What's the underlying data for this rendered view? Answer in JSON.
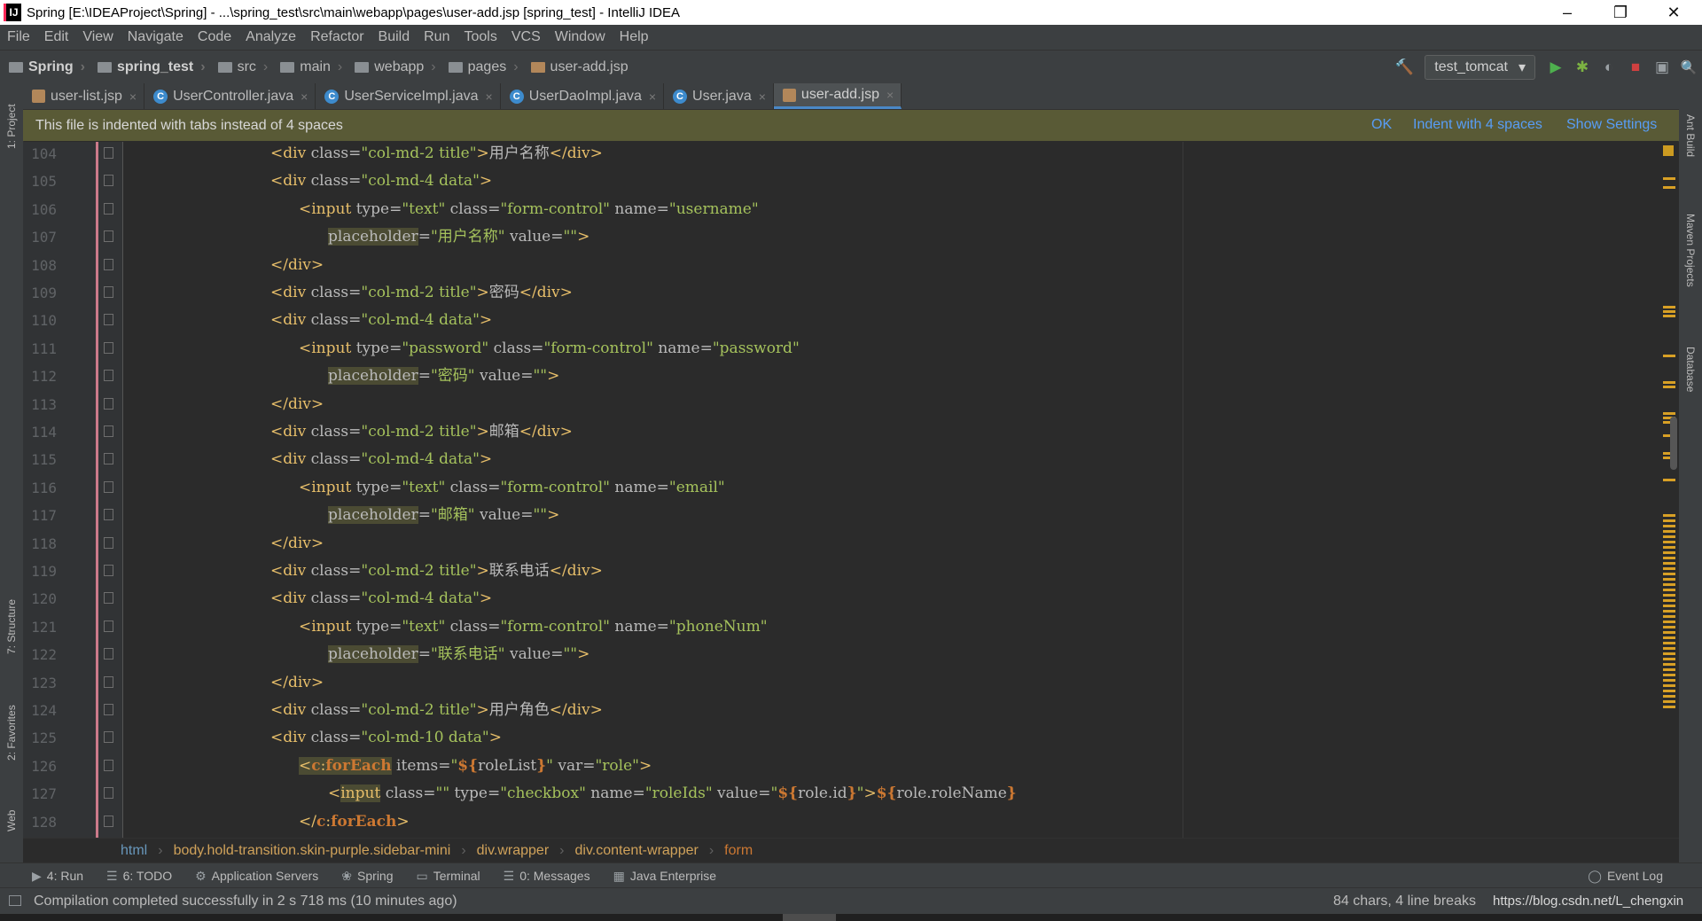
{
  "window": {
    "title": "Spring [E:\\IDEAProject\\Spring] - ...\\spring_test\\src\\main\\webapp\\pages\\user-add.jsp [spring_test] - IntelliJ IDEA",
    "icon_letter": "IJ",
    "controls": {
      "minimize": "–",
      "maximize": "❐",
      "close": "✕"
    }
  },
  "menu": [
    "File",
    "Edit",
    "View",
    "Navigate",
    "Code",
    "Analyze",
    "Refactor",
    "Build",
    "Run",
    "Tools",
    "VCS",
    "Window",
    "Help"
  ],
  "breadcrumbs": [
    "Spring",
    "spring_test",
    "src",
    "main",
    "webapp",
    "pages",
    "user-add.jsp"
  ],
  "run_config": {
    "label": "test_tomcat",
    "dropdown": "▾"
  },
  "toolbar_icons": {
    "build": "🔨",
    "run": "▶",
    "debug": "✱",
    "coverage": "◐",
    "stop": "■",
    "structure": "▣",
    "search": "🔍"
  },
  "tabs": [
    {
      "label": "user-list.jsp",
      "kind": "jsp",
      "active": false
    },
    {
      "label": "UserController.java",
      "kind": "class",
      "active": false
    },
    {
      "label": "UserServiceImpl.java",
      "kind": "class",
      "active": false
    },
    {
      "label": "UserDaoImpl.java",
      "kind": "class",
      "active": false
    },
    {
      "label": "User.java",
      "kind": "class",
      "active": false
    },
    {
      "label": "user-add.jsp",
      "kind": "jsp",
      "active": true
    }
  ],
  "tab_close": "×",
  "notice": {
    "message": "This file is indented with tabs instead of 4 spaces",
    "actions": [
      "OK",
      "Indent with 4 spaces",
      "Show Settings"
    ]
  },
  "left_panels": [
    "1: Project",
    "7: Structure",
    "2: Favorites",
    "Web"
  ],
  "right_panels": [
    "Ant Build",
    "Maven Projects",
    "Database"
  ],
  "code_lines": [
    {
      "n": "104",
      "html": "<span class=\"t\">&lt;div </span><span class=\"a\">class=</span><span class=\"s\">\"col-md-2 title\"</span><span class=\"t\">&gt;</span><span class=\"p\">用户名称</span><span class=\"t\">&lt;/div&gt;</span>",
      "indent": 279
    },
    {
      "n": "105",
      "html": "<span class=\"t\">&lt;div </span><span class=\"a\">class=</span><span class=\"s\">\"col-md-4 data\"</span><span class=\"t\">&gt;</span>",
      "indent": 279
    },
    {
      "n": "106",
      "html": "<span class=\"t\">&lt;input </span><span class=\"a\">type=</span><span class=\"s\">\"text\"</span><span class=\"a\"> class=</span><span class=\"s\">\"form-control\"</span><span class=\"a\"> name=</span><span class=\"s\">\"username\"</span>",
      "indent": 311
    },
    {
      "n": "107",
      "html": "<span class=\"a hl\">placeholder</span><span class=\"a\">=</span><span class=\"s\">\"用户名称\"</span><span class=\"a\"> value=</span><span class=\"s\">\"\"</span><span class=\"t\">&gt;</span>",
      "indent": 344
    },
    {
      "n": "108",
      "html": "<span class=\"t\">&lt;/div&gt;</span>",
      "indent": 279
    },
    {
      "n": "109",
      "html": "<span class=\"t\">&lt;div </span><span class=\"a\">class=</span><span class=\"s\">\"col-md-2 title\"</span><span class=\"t\">&gt;</span><span class=\"p\">密码</span><span class=\"t\">&lt;/div&gt;</span>",
      "indent": 279
    },
    {
      "n": "110",
      "html": "<span class=\"t\">&lt;div </span><span class=\"a\">class=</span><span class=\"s\">\"col-md-4 data\"</span><span class=\"t\">&gt;</span>",
      "indent": 279
    },
    {
      "n": "111",
      "html": "<span class=\"t\">&lt;input </span><span class=\"a\">type=</span><span class=\"s\">\"password\"</span><span class=\"a\"> class=</span><span class=\"s\">\"form-control\"</span><span class=\"a\"> name=</span><span class=\"s\">\"password\"</span>",
      "indent": 311
    },
    {
      "n": "112",
      "html": "<span class=\"a hl\">placeholder</span><span class=\"a\">=</span><span class=\"s\">\"密码\"</span><span class=\"a\"> value=</span><span class=\"s\">\"\"</span><span class=\"t\">&gt;</span>",
      "indent": 344
    },
    {
      "n": "113",
      "html": "<span class=\"t\">&lt;/div&gt;</span>",
      "indent": 279
    },
    {
      "n": "114",
      "html": "<span class=\"t\">&lt;div </span><span class=\"a\">class=</span><span class=\"s\">\"col-md-2 title\"</span><span class=\"t\">&gt;</span><span class=\"p\">邮箱</span><span class=\"t\">&lt;/div&gt;</span>",
      "indent": 279
    },
    {
      "n": "115",
      "html": "<span class=\"t\">&lt;div </span><span class=\"a\">class=</span><span class=\"s\">\"col-md-4 data\"</span><span class=\"t\">&gt;</span>",
      "indent": 279
    },
    {
      "n": "116",
      "html": "<span class=\"t\">&lt;input </span><span class=\"a\">type=</span><span class=\"s\">\"text\"</span><span class=\"a\"> class=</span><span class=\"s\">\"form-control\"</span><span class=\"a\"> name=</span><span class=\"s\">\"email\"</span>",
      "indent": 311
    },
    {
      "n": "117",
      "html": "<span class=\"a hl\">placeholder</span><span class=\"a\">=</span><span class=\"s\">\"邮箱\"</span><span class=\"a\"> value=</span><span class=\"s\">\"\"</span><span class=\"t\">&gt;</span>",
      "indent": 344
    },
    {
      "n": "118",
      "html": "<span class=\"t\">&lt;/div&gt;</span>",
      "indent": 279
    },
    {
      "n": "119",
      "html": "<span class=\"t\">&lt;div </span><span class=\"a\">class=</span><span class=\"s\">\"col-md-2 title\"</span><span class=\"t\">&gt;</span><span class=\"p\">联系电话</span><span class=\"t\">&lt;/div&gt;</span>",
      "indent": 279
    },
    {
      "n": "120",
      "html": "<span class=\"t\">&lt;div </span><span class=\"a\">class=</span><span class=\"s\">\"col-md-4 data\"</span><span class=\"t\">&gt;</span>",
      "indent": 279
    },
    {
      "n": "121",
      "html": "<span class=\"t\">&lt;input </span><span class=\"a\">type=</span><span class=\"s\">\"text\"</span><span class=\"a\"> class=</span><span class=\"s\">\"form-control\"</span><span class=\"a\"> name=</span><span class=\"s\">\"phoneNum\"</span>",
      "indent": 311
    },
    {
      "n": "122",
      "html": "<span class=\"a hl\">placeholder</span><span class=\"a\">=</span><span class=\"s\">\"联系电话\"</span><span class=\"a\"> value=</span><span class=\"s\">\"\"</span><span class=\"t\">&gt;</span>",
      "indent": 344
    },
    {
      "n": "123",
      "html": "<span class=\"t\">&lt;/div&gt;</span>",
      "indent": 279
    },
    {
      "n": "124",
      "html": "<span class=\"t\">&lt;div </span><span class=\"a\">class=</span><span class=\"s\">\"col-md-2 title\"</span><span class=\"t\">&gt;</span><span class=\"p\">用户角色</span><span class=\"t\">&lt;/div&gt;</span>",
      "indent": 279
    },
    {
      "n": "125",
      "html": "<span class=\"t\">&lt;div </span><span class=\"a\">class=</span><span class=\"s\">\"col-md-10 data\"</span><span class=\"t\">&gt;</span>",
      "indent": 279
    },
    {
      "n": "126",
      "html": "<span class=\"t hl\">&lt;</span><span class=\"k hl\">c</span><span class=\"t hl\">:</span><span class=\"k hl\">forEach</span><span class=\"a\"> items=</span><span class=\"s\">\"</span><span class=\"k\">${</span><span class=\"p\">roleList</span><span class=\"k\">}</span><span class=\"s\">\"</span><span class=\"a\"> var=</span><span class=\"s\">\"role\"</span><span class=\"t\">&gt;</span>",
      "indent": 311
    },
    {
      "n": "127",
      "html": "<span class=\"t\">&lt;</span><span class=\"t hl\">input</span><span class=\"a\"> class=</span><span class=\"s\">\"\"</span><span class=\"a\"> type=</span><span class=\"s\">\"checkbox\"</span><span class=\"a\"> name=</span><span class=\"s\">\"roleIds\"</span><span class=\"a\"> value=</span><span class=\"s\">\"</span><span class=\"k\">${</span><span class=\"p\">role.id</span><span class=\"k\">}</span><span class=\"s\">\"</span><span class=\"t\">&gt;</span><span class=\"k\">${</span><span class=\"p\">role.roleName</span><span class=\"k\">}</span>",
      "indent": 344
    },
    {
      "n": "128",
      "html": "<span class=\"t\">&lt;/</span><span class=\"k\">c</span><span class=\"t\">:</span><span class=\"k\">forEach</span><span class=\"t\">&gt;</span>",
      "indent": 311
    }
  ],
  "bottom_breadcrumbs": [
    "html",
    "body.hold-transition.skin-purple.sidebar-mini",
    "div.wrapper",
    "div.content-wrapper",
    "form"
  ],
  "tool_windows": [
    {
      "icon": "▶",
      "label": "4: Run"
    },
    {
      "icon": "☰",
      "label": "6: TODO"
    },
    {
      "icon": "⚙",
      "label": "Application Servers"
    },
    {
      "icon": "❀",
      "label": "Spring"
    },
    {
      "icon": "▭",
      "label": "Terminal"
    },
    {
      "icon": "☰",
      "label": "0: Messages"
    },
    {
      "icon": "▦",
      "label": "Java Enterprise"
    }
  ],
  "event_log": "Event Log",
  "status": {
    "message": "Compilation completed successfully in 2 s 718 ms (10 minutes ago)",
    "info": "84 chars, 4 line breaks",
    "overlay": "https://blog.csdn.net/L_chengxin"
  },
  "colors": {
    "accent": "#4a88c7",
    "notice_bg": "#595a36",
    "link": "#589df6",
    "tag": "#e8bf6a",
    "string": "#a5c25c",
    "keyword": "#cc7832"
  }
}
